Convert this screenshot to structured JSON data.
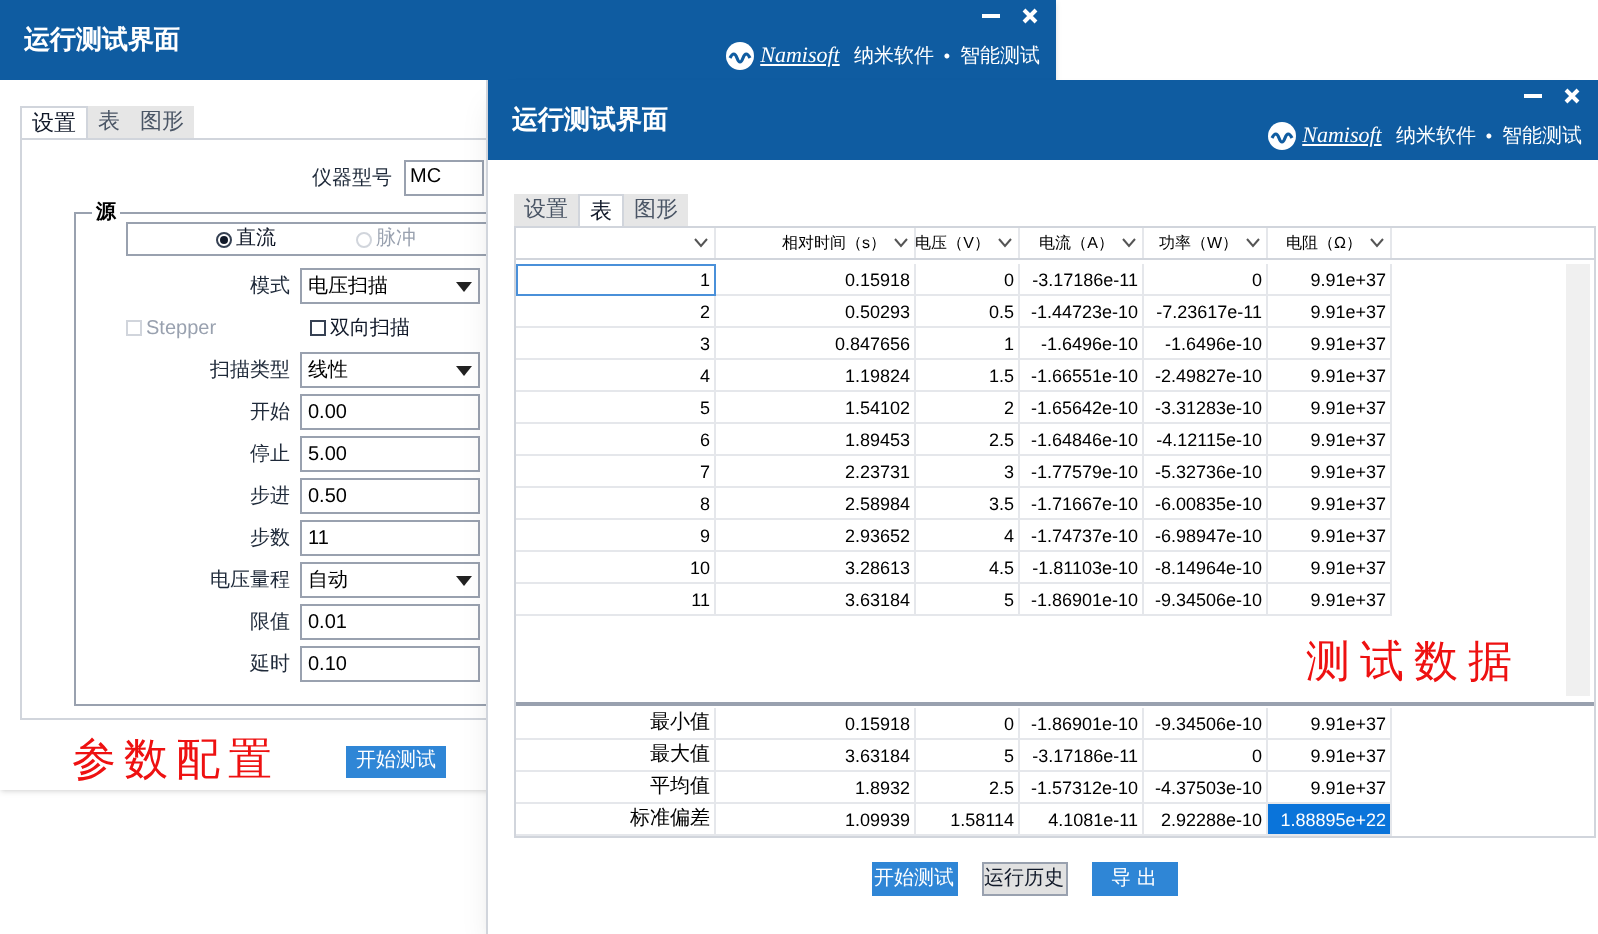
{
  "back_window": {
    "title": "运行测试界面",
    "logo": {
      "brand": "Namisoft",
      "tagline_1": "纳米软件",
      "separator": "•",
      "tagline_2": "智能测试"
    },
    "tabs": [
      {
        "label": "设置",
        "selected": true
      },
      {
        "label": "表",
        "selected": false
      },
      {
        "label": "图形",
        "selected": false
      }
    ],
    "instrument_model": {
      "label": "仪器型号",
      "value": "MC"
    },
    "source": {
      "label": "源",
      "radios": [
        {
          "label": "直流",
          "selected": true,
          "disabled": false
        },
        {
          "label": "脉冲",
          "selected": false,
          "disabled": true
        }
      ],
      "fields": [
        {
          "kind": "select",
          "label": "模式",
          "value": "电压扫描"
        },
        {
          "kind": "checkboxes",
          "items": [
            {
              "label": "Stepper",
              "checked": false,
              "disabled": true
            },
            {
              "label": "双向扫描",
              "checked": false,
              "disabled": false
            }
          ]
        },
        {
          "kind": "select",
          "label": "扫描类型",
          "value": "线性"
        },
        {
          "kind": "input",
          "label": "开始",
          "value": "0.00"
        },
        {
          "kind": "input",
          "label": "停止",
          "value": "5.00"
        },
        {
          "kind": "input",
          "label": "步进",
          "value": "0.50"
        },
        {
          "kind": "input",
          "label": "步数",
          "value": "11"
        },
        {
          "kind": "select",
          "label": "电压量程",
          "value": "自动"
        },
        {
          "kind": "input",
          "label": "限值",
          "value": "0.01"
        },
        {
          "kind": "input",
          "label": "延时",
          "value": "0.10"
        }
      ]
    },
    "annotation": "参数配置",
    "start_button": "开始测试"
  },
  "front_window": {
    "title": "运行测试界面",
    "logo": {
      "brand": "Namisoft",
      "tagline_1": "纳米软件",
      "separator": "•",
      "tagline_2": "智能测试"
    },
    "tabs": [
      {
        "label": "设置",
        "selected": false
      },
      {
        "label": "表",
        "selected": true
      },
      {
        "label": "图形",
        "selected": false
      }
    ],
    "table": {
      "columns": [
        "",
        "相对时间（s）",
        "电压（V）",
        "电流（A）",
        "功率（W）",
        "电阻（Ω）"
      ],
      "rows": [
        {
          "cells": [
            {
              "text": "1",
              "selected": true
            },
            {
              "text": "0.15918",
              "selected": false
            },
            {
              "text": "0",
              "selected": false
            },
            {
              "text": "-3.17186e-11",
              "selected": false
            },
            {
              "text": "0",
              "selected": false
            },
            {
              "text": "9.91e+37",
              "selected": false
            }
          ]
        },
        {
          "cells": [
            {
              "text": "2",
              "selected": false
            },
            {
              "text": "0.50293",
              "selected": false
            },
            {
              "text": "0.5",
              "selected": false
            },
            {
              "text": "-1.44723e-10",
              "selected": false
            },
            {
              "text": "-7.23617e-11",
              "selected": false
            },
            {
              "text": "9.91e+37",
              "selected": false
            }
          ]
        },
        {
          "cells": [
            {
              "text": "3",
              "selected": false
            },
            {
              "text": "0.847656",
              "selected": false
            },
            {
              "text": "1",
              "selected": false
            },
            {
              "text": "-1.6496e-10",
              "selected": false
            },
            {
              "text": "-1.6496e-10",
              "selected": false
            },
            {
              "text": "9.91e+37",
              "selected": false
            }
          ]
        },
        {
          "cells": [
            {
              "text": "4",
              "selected": false
            },
            {
              "text": "1.19824",
              "selected": false
            },
            {
              "text": "1.5",
              "selected": false
            },
            {
              "text": "-1.66551e-10",
              "selected": false
            },
            {
              "text": "-2.49827e-10",
              "selected": false
            },
            {
              "text": "9.91e+37",
              "selected": false
            }
          ]
        },
        {
          "cells": [
            {
              "text": "5",
              "selected": false
            },
            {
              "text": "1.54102",
              "selected": false
            },
            {
              "text": "2",
              "selected": false
            },
            {
              "text": "-1.65642e-10",
              "selected": false
            },
            {
              "text": "-3.31283e-10",
              "selected": false
            },
            {
              "text": "9.91e+37",
              "selected": false
            }
          ]
        },
        {
          "cells": [
            {
              "text": "6",
              "selected": false
            },
            {
              "text": "1.89453",
              "selected": false
            },
            {
              "text": "2.5",
              "selected": false
            },
            {
              "text": "-1.64846e-10",
              "selected": false
            },
            {
              "text": "-4.12115e-10",
              "selected": false
            },
            {
              "text": "9.91e+37",
              "selected": false
            }
          ]
        },
        {
          "cells": [
            {
              "text": "7",
              "selected": false
            },
            {
              "text": "2.23731",
              "selected": false
            },
            {
              "text": "3",
              "selected": false
            },
            {
              "text": "-1.77579e-10",
              "selected": false
            },
            {
              "text": "-5.32736e-10",
              "selected": false
            },
            {
              "text": "9.91e+37",
              "selected": false
            }
          ]
        },
        {
          "cells": [
            {
              "text": "8",
              "selected": false
            },
            {
              "text": "2.58984",
              "selected": false
            },
            {
              "text": "3.5",
              "selected": false
            },
            {
              "text": "-1.71667e-10",
              "selected": false
            },
            {
              "text": "-6.00835e-10",
              "selected": false
            },
            {
              "text": "9.91e+37",
              "selected": false
            }
          ]
        },
        {
          "cells": [
            {
              "text": "9",
              "selected": false
            },
            {
              "text": "2.93652",
              "selected": false
            },
            {
              "text": "4",
              "selected": false
            },
            {
              "text": "-1.74737e-10",
              "selected": false
            },
            {
              "text": "-6.98947e-10",
              "selected": false
            },
            {
              "text": "9.91e+37",
              "selected": false
            }
          ]
        },
        {
          "cells": [
            {
              "text": "10",
              "selected": false
            },
            {
              "text": "3.28613",
              "selected": false
            },
            {
              "text": "4.5",
              "selected": false
            },
            {
              "text": "-1.81103e-10",
              "selected": false
            },
            {
              "text": "-8.14964e-10",
              "selected": false
            },
            {
              "text": "9.91e+37",
              "selected": false
            }
          ]
        },
        {
          "cells": [
            {
              "text": "11",
              "selected": false
            },
            {
              "text": "3.63184",
              "selected": false
            },
            {
              "text": "5",
              "selected": false
            },
            {
              "text": "-1.86901e-10",
              "selected": false
            },
            {
              "text": "-9.34506e-10",
              "selected": false
            },
            {
              "text": "9.91e+37",
              "selected": false
            }
          ]
        }
      ],
      "summary_rows": [
        {
          "cells": [
            {
              "text": "最小值",
              "selected": false
            },
            {
              "text": "0.15918",
              "selected": false
            },
            {
              "text": "0",
              "selected": false
            },
            {
              "text": "-1.86901e-10",
              "selected": false
            },
            {
              "text": "-9.34506e-10",
              "selected": false
            },
            {
              "text": "9.91e+37",
              "selected": false
            }
          ]
        },
        {
          "cells": [
            {
              "text": "最大值",
              "selected": false
            },
            {
              "text": "3.63184",
              "selected": false
            },
            {
              "text": "5",
              "selected": false
            },
            {
              "text": "-3.17186e-11",
              "selected": false
            },
            {
              "text": "0",
              "selected": false
            },
            {
              "text": "9.91e+37",
              "selected": false
            }
          ]
        },
        {
          "cells": [
            {
              "text": "平均值",
              "selected": false
            },
            {
              "text": "1.8932",
              "selected": false
            },
            {
              "text": "2.5",
              "selected": false
            },
            {
              "text": "-1.57312e-10",
              "selected": false
            },
            {
              "text": "-4.37503e-10",
              "selected": false
            },
            {
              "text": "9.91e+37",
              "selected": false
            }
          ]
        },
        {
          "cells": [
            {
              "text": "标准偏差",
              "selected": false
            },
            {
              "text": "1.09939",
              "selected": false
            },
            {
              "text": "1.58114",
              "selected": false
            },
            {
              "text": "4.1081e-11",
              "selected": false
            },
            {
              "text": "2.92288e-10",
              "selected": false
            },
            {
              "text": "1.88895e+22",
              "selected": true
            }
          ]
        }
      ]
    },
    "annotation": "测试数据",
    "buttons": [
      {
        "label": "开始测试",
        "kind": "primary"
      },
      {
        "label": "运行历史",
        "kind": "secondary"
      },
      {
        "label": "导 出",
        "kind": "primary"
      }
    ]
  }
}
